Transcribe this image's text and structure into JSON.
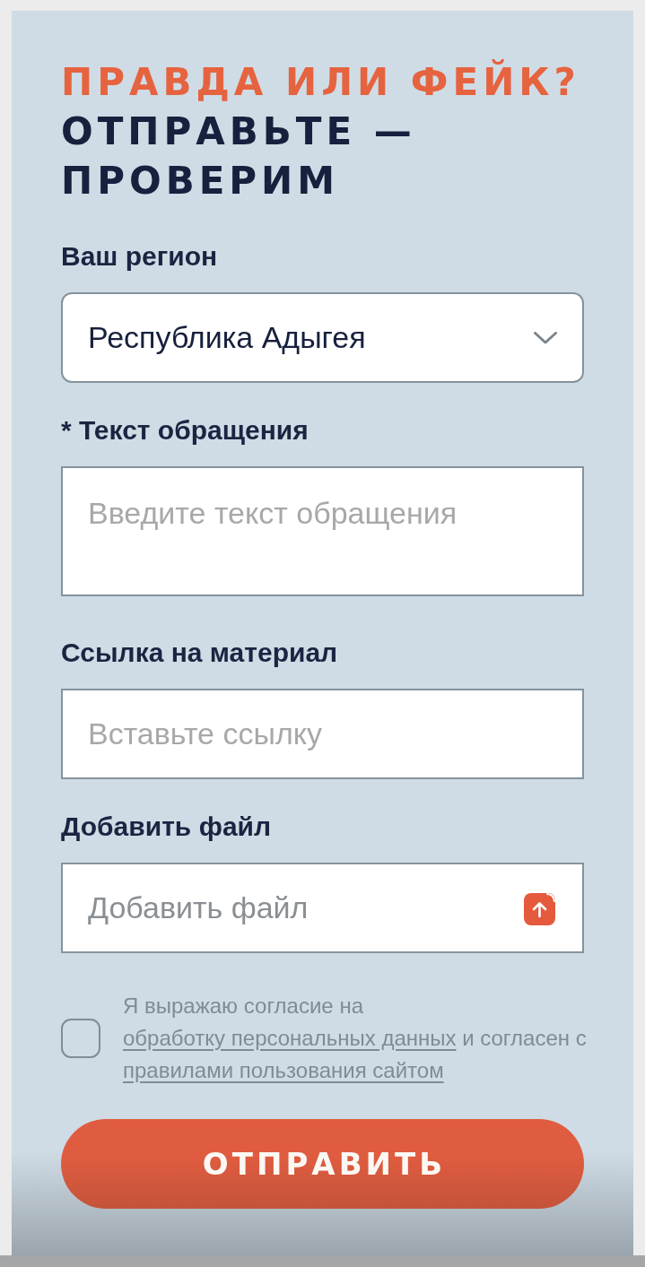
{
  "title": {
    "question": "ПРАВДА ИЛИ ФЕЙК?",
    "call": "ОТПРАВЬТЕ — ПРОВЕРИМ"
  },
  "fields": [
    {
      "kind": "select",
      "label": "Ваш регион",
      "value": "Республика Адыгея"
    },
    {
      "kind": "textarea",
      "label": "* Текст обращения",
      "placeholder": "Введите текст обращения"
    },
    {
      "kind": "url",
      "label": "Ссылка на материал",
      "placeholder": "Вставьте ссылку"
    },
    {
      "kind": "file",
      "label": "Добавить файл",
      "placeholder": "Добавить файл"
    }
  ],
  "consent": {
    "checked": false,
    "parts": [
      {
        "kind": "text",
        "text": "Я выражаю согласие на "
      },
      {
        "kind": "link",
        "text": "обработку персональных данных"
      },
      {
        "kind": "text",
        "text": " и согласен с "
      },
      {
        "kind": "link",
        "text": "правилами пользования сайтом"
      }
    ]
  },
  "submit_button": {
    "label": "ОТПРАВИТЬ"
  }
}
